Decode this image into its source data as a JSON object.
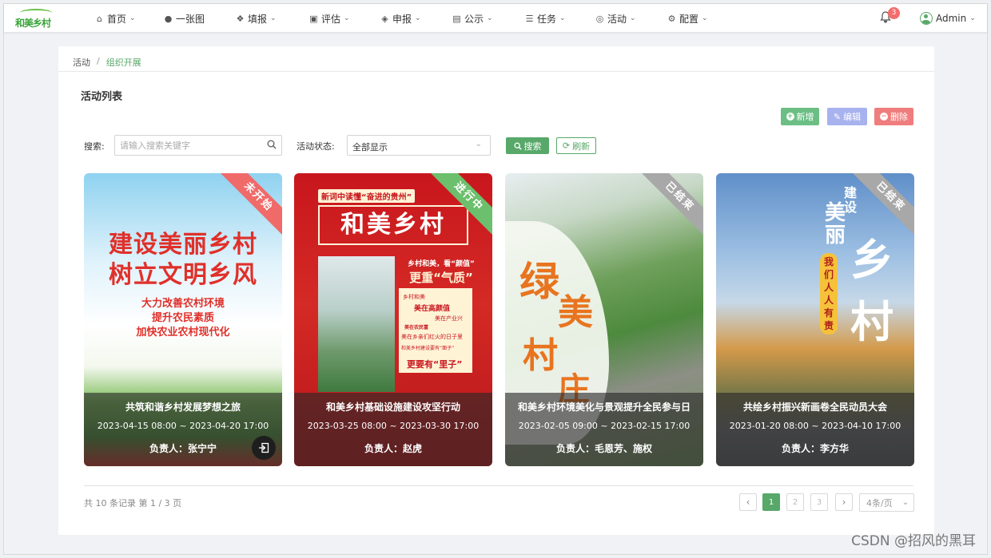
{
  "nav": {
    "logo_text": "和美乡村",
    "items": [
      {
        "label": "首页",
        "icon": "home-icon",
        "has_menu": true
      },
      {
        "label": "一张图",
        "icon": "globe-icon",
        "has_menu": false
      },
      {
        "label": "填报",
        "icon": "cubes-icon",
        "has_menu": true
      },
      {
        "label": "评估",
        "icon": "assess-icon",
        "has_menu": true
      },
      {
        "label": "申报",
        "icon": "layers-icon",
        "has_menu": true
      },
      {
        "label": "公示",
        "icon": "notice-icon",
        "has_menu": true
      },
      {
        "label": "任务",
        "icon": "task-icon",
        "has_menu": true
      },
      {
        "label": "活动",
        "icon": "lifebuoy-icon",
        "has_menu": true
      },
      {
        "label": "配置",
        "icon": "gear-icon",
        "has_menu": true
      }
    ],
    "notification_count": "3",
    "user_name": "Admin"
  },
  "breadcrumb": {
    "root": "活动",
    "separator": "/",
    "current": "组织开展"
  },
  "page_title": "活动列表",
  "toolbar": {
    "add": "新增",
    "edit": "编辑",
    "delete": "删除"
  },
  "filters": {
    "search_label": "搜索:",
    "search_placeholder": "请输入搜索关键字",
    "status_label": "活动状态:",
    "status_value": "全部显示",
    "search_button": "搜索",
    "refresh_button": "刷新"
  },
  "cards": [
    {
      "status": "未开始",
      "status_color": "#f06a6a",
      "title": "共筑和谐乡村发展梦想之旅",
      "date": "2023-04-15 08:00 ~ 2023-04-20 17:00",
      "owner": "负责人：张宁宁",
      "poster_lines": [
        "建设美丽乡村",
        "树立文明乡风",
        "大力改善农村环境",
        "提升农民素质",
        "加快农业农村现代化"
      ]
    },
    {
      "status": "进行中",
      "status_color": "#6cbf6c",
      "title": "和美乡村基础设施建设攻坚行动",
      "date": "2023-03-25 08:00 ~ 2023-03-30 17:00",
      "owner": "负责人：赵虎",
      "poster_lines": [
        "新词中读懂“奋进的贵州”",
        "和美乡村",
        "乡村和美，看“颜值”",
        "更重“气质”",
        "乡村和美",
        "美在高颜值",
        "美在产业兴",
        "美在农民富",
        "美在乡亲们红火的日子里",
        "和美乡村建设要有“面子”",
        "更要有“里子”"
      ]
    },
    {
      "status": "已结束",
      "status_color": "#a8a8a8",
      "title": "和美乡村环境美化与景观提升全民参与日",
      "date": "2023-02-05 09:00 ~ 2023-02-15 17:00",
      "owner": "负责人：毛恩芳、施权",
      "poster_lines": [
        "绿",
        "美",
        "村",
        "庄"
      ]
    },
    {
      "status": "已结束",
      "status_color": "#a8a8a8",
      "title": "共绘乡村振兴新画卷全民动员大会",
      "date": "2023-01-20 08:00 ~ 2023-04-10 17:00",
      "owner": "负责人：李方华",
      "poster_lines": [
        "建设",
        "美丽",
        "乡村",
        "我们人人有责"
      ]
    }
  ],
  "pagination": {
    "summary": "共 10 条记录 第 1 / 3 页",
    "pages": [
      "1",
      "2",
      "3"
    ],
    "current": "1",
    "page_size": "4条/页"
  },
  "watermark": "CSDN @招风的黑耳",
  "colors": {
    "primary": "#57a869",
    "add": "#6cbf84",
    "edit": "#a8b2ee",
    "delete": "#f07d7d"
  }
}
